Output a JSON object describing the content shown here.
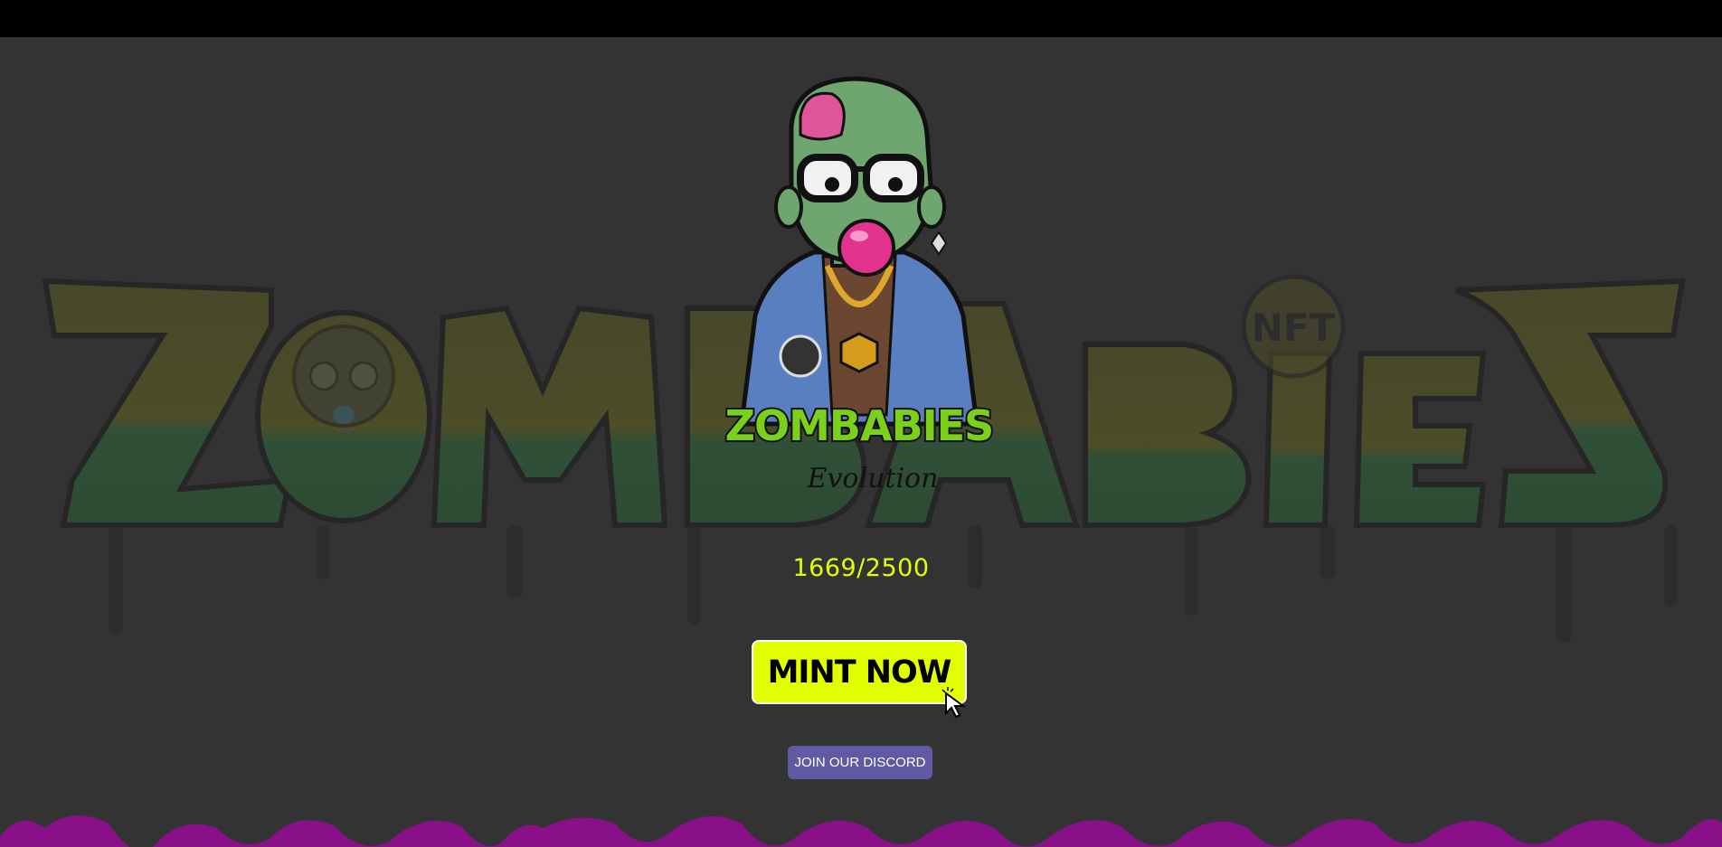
{
  "mint": {
    "count_text": "1669/2500",
    "button_label": "MINT NOW"
  },
  "discord": {
    "button_label": "JOIN OUR DISCORD"
  },
  "branding": {
    "logo_text": "ZOMBABIES",
    "logo_subtitle": "Evolution",
    "background_text": "ZOMBABIES",
    "nft_badge": "NFT"
  },
  "colors": {
    "background": "#333333",
    "topbar": "#000000",
    "mint_button": "#e2ff00",
    "count_text": "#e2ff00",
    "discord_button": "#5f5aa2",
    "goo": "#8a108a",
    "logo_green": "#7bd01b",
    "logo_yellow": "#f5e400"
  },
  "icons": {
    "cursor": "pointer-cursor-icon"
  }
}
